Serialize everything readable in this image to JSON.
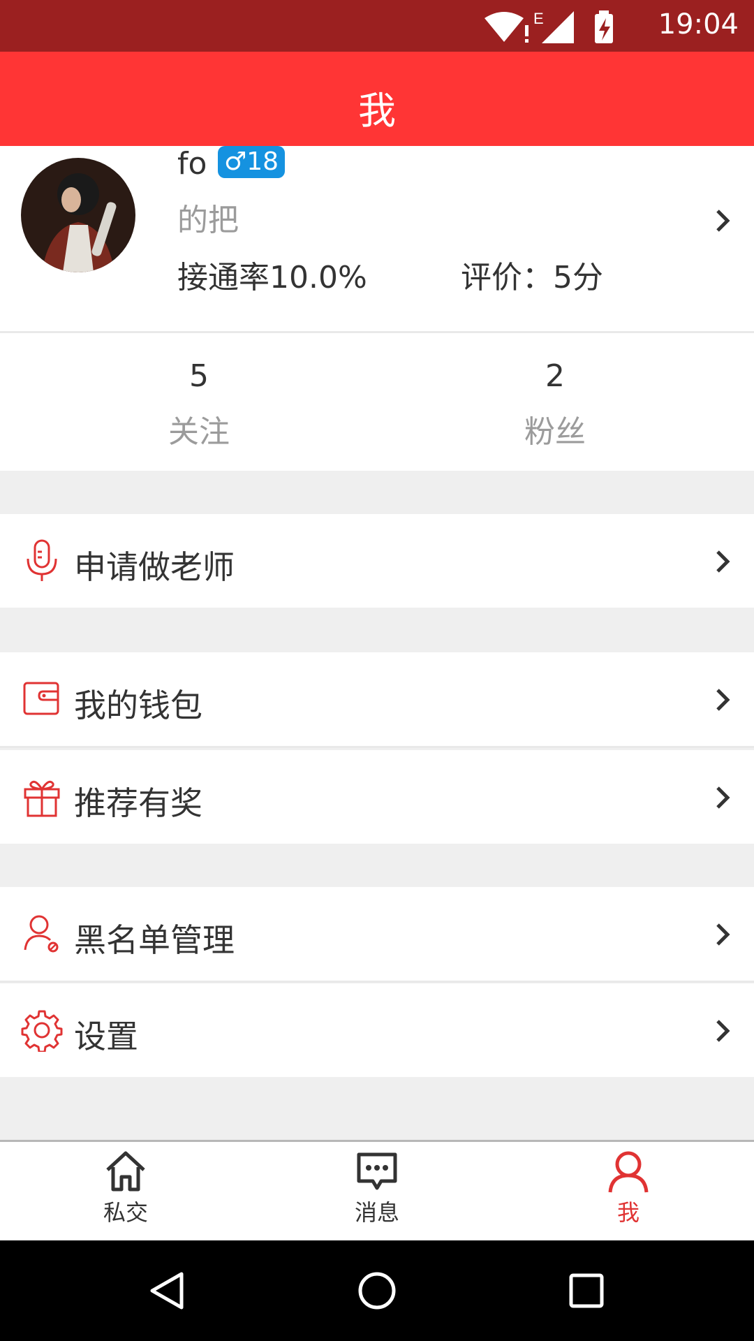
{
  "status_bar": {
    "time": "19:04",
    "network_type": "E"
  },
  "app_bar": {
    "title": "我"
  },
  "profile": {
    "username": "fo",
    "gender_age_badge": "♂18",
    "signature": "的把",
    "answer_rate": "接通率10.0%",
    "rating": "评价：5分"
  },
  "stats": [
    {
      "count": "5",
      "label": "关注"
    },
    {
      "count": "2",
      "label": "粉丝"
    }
  ],
  "menu": [
    {
      "label": "申请做老师",
      "icon": "microphone-icon"
    },
    {
      "label": "我的钱包",
      "icon": "wallet-icon"
    },
    {
      "label": "推荐有奖",
      "icon": "gift-icon"
    },
    {
      "label": "黑名单管理",
      "icon": "blacklist-user-icon"
    },
    {
      "label": "设置",
      "icon": "settings-gear-icon"
    }
  ],
  "bottom_nav": [
    {
      "label": "私交",
      "icon": "home-icon",
      "active": false
    },
    {
      "label": "消息",
      "icon": "message-icon",
      "active": false
    },
    {
      "label": "我",
      "icon": "person-icon",
      "active": true
    }
  ],
  "colors": {
    "status_bar": "#9b2020",
    "app_bar": "#ff3535",
    "accent": "#e03333",
    "badge": "#1592e0",
    "background": "#efefef"
  }
}
